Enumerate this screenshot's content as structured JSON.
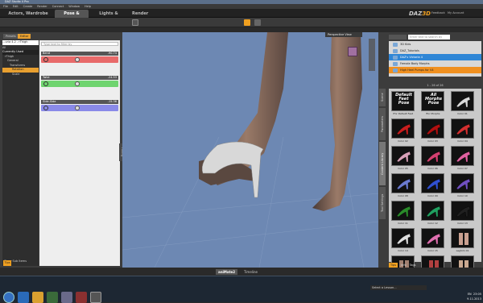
{
  "window": {
    "title": "DAZ Studio 4 Pro"
  },
  "menubar": {
    "items": [
      "File",
      "Edit",
      "Create",
      "Render",
      "Connect",
      "Window",
      "Help"
    ]
  },
  "rooms": {
    "tabs": [
      "Actors, Wardrobe & Props",
      "Pose & Animate",
      "Lights & Cameras",
      "Render"
    ],
    "active": "Pose & Animate"
  },
  "brand": {
    "daz": "DAZ",
    "suffix": "3D",
    "links": [
      "Feedback",
      "My Account"
    ]
  },
  "left_panel": {
    "tabs": [
      "Presets",
      "Editor"
    ],
    "selector": "...uria 4.2 - rThigh",
    "filter_placeholder": "Type text to filter by",
    "tree": [
      "All",
      "Currently Used",
      "rThigh",
      "General",
      "Transforms",
      "Rotation",
      "Scale"
    ],
    "sliders": [
      {
        "label": "Bend",
        "value": "-90.74",
        "color": "#e86a6a"
      },
      {
        "label": "Twist",
        "value": "-24.53",
        "color": "#6fd46f"
      },
      {
        "label": "Side-Side",
        "value": "-15.36",
        "color": "#8a8ae8"
      }
    ],
    "show_sub": "Show Sub Items",
    "tips": "Tips"
  },
  "viewport": {
    "label": "Perspective View",
    "posing": "Posing"
  },
  "right_panel": {
    "search_placeholder": "Enter text to search by",
    "side_tabs": [
      "Scene",
      "Parameters",
      "Content Library",
      "Tool Settings"
    ],
    "active_tab": "Content Library",
    "folders": [
      "3D Kids",
      "DAZ_Tutorials",
      "DAZ's Victoria 4",
      "Female Body Morphs",
      "High Heel Pumps for V4"
    ],
    "paging": "1 - 26 of 26",
    "thumbnails": [
      {
        "label": "!For Default Feet",
        "pose": "Default Feet Pose",
        "type": "pose"
      },
      {
        "label": "!For Morphs",
        "pose": "All Morphs Pose",
        "type": "pose"
      },
      {
        "label": "Color 01",
        "color": "#d9d9d9",
        "type": "shoe"
      },
      {
        "label": "Color 02",
        "color": "#c81e1e",
        "type": "shoe"
      },
      {
        "label": "Color 03",
        "color": "#b01010",
        "type": "shoe"
      },
      {
        "label": "Color 04",
        "color": "#d43030",
        "type": "shoe"
      },
      {
        "label": "Color 05",
        "color": "#d8a0b8",
        "type": "shoe"
      },
      {
        "label": "Color 06",
        "color": "#d44070",
        "type": "shoe"
      },
      {
        "label": "Color 07",
        "color": "#e060a0",
        "type": "shoe"
      },
      {
        "label": "Color 08",
        "color": "#6a7ad0",
        "type": "shoe"
      },
      {
        "label": "Color 09",
        "color": "#3050d0",
        "type": "shoe"
      },
      {
        "label": "Color 10",
        "color": "#7050c0",
        "type": "shoe"
      },
      {
        "label": "Color 11",
        "color": "#2a8a2a",
        "type": "shoe"
      },
      {
        "label": "Color 12",
        "color": "#20a060",
        "type": "shoe"
      },
      {
        "label": "Color 13",
        "color": "#202020",
        "type": "shoe"
      },
      {
        "label": "Color 14",
        "color": "#e0e0e0",
        "type": "shoe"
      },
      {
        "label": "Color 15",
        "color": "#e070b0",
        "type": "shoe"
      },
      {
        "label": "LegSim 01",
        "color": "#c9a090",
        "type": "leg"
      },
      {
        "label": "",
        "color": "#a08070",
        "type": "leg"
      },
      {
        "label": "",
        "color": "#b04040",
        "type": "leg"
      },
      {
        "label": "",
        "color": "#c9a890",
        "type": "leg"
      }
    ],
    "bottom_tabs": [
      "Tips",
      "Info",
      "Tags"
    ]
  },
  "bottom": {
    "tabs": [
      "aniMate2",
      "Timeline"
    ],
    "active": "aniMate2"
  },
  "lessons": {
    "label": "Select a Lesson..."
  },
  "taskbar": {
    "time": "23:05",
    "date": "9.11.2013",
    "lang": "EN"
  }
}
